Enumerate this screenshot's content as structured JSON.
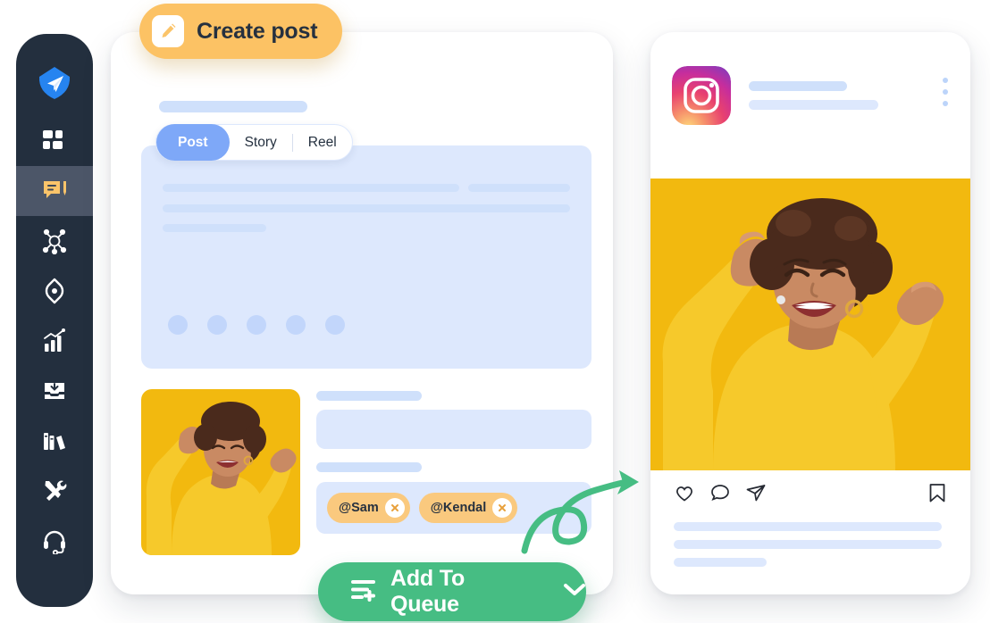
{
  "app": {
    "sidebar": {
      "items": [
        {
          "name": "logo",
          "icon": "paper-plane-logo-icon",
          "active": false
        },
        {
          "name": "dashboard",
          "icon": "grid-dashboard-icon",
          "active": false
        },
        {
          "name": "create-post",
          "icon": "chat-bubble-pencil-icon",
          "active": true
        },
        {
          "name": "engage",
          "icon": "network-nodes-icon",
          "active": false
        },
        {
          "name": "discover",
          "icon": "diamond-compass-icon",
          "active": false
        },
        {
          "name": "analytics",
          "icon": "bar-chart-growth-icon",
          "active": false
        },
        {
          "name": "inbox",
          "icon": "inbox-download-icon",
          "active": false
        },
        {
          "name": "library",
          "icon": "books-library-icon",
          "active": false
        },
        {
          "name": "tools",
          "icon": "wrench-screwdriver-icon",
          "active": false
        },
        {
          "name": "support",
          "icon": "headset-support-icon",
          "active": false
        }
      ]
    },
    "create_post_pill": {
      "label": "Create post",
      "icon": "pencil-square-icon",
      "bg_color": "#fcc264"
    },
    "editor": {
      "tabs": [
        {
          "label": "Post",
          "active": true
        },
        {
          "label": "Story",
          "active": false
        },
        {
          "label": "Reel",
          "active": false
        }
      ],
      "active_tab_color": "#7ea8f8",
      "tag_field": {
        "tags": [
          {
            "label": "@Sam",
            "remove_icon": "close-icon"
          },
          {
            "label": "@Kendal",
            "remove_icon": "close-icon"
          }
        ],
        "chip_color": "#fac97e"
      },
      "carousel_dot_count": 5
    },
    "queue_button": {
      "label": "Add To Queue",
      "leading_icon": "queue-list-add-icon",
      "trailing_icon": "chevron-down-icon",
      "bg_color": "#46bd83"
    },
    "arrow": {
      "icon": "curved-arrow-right-icon",
      "color": "#46bd83"
    },
    "preview": {
      "network": "instagram",
      "network_icon": "instagram-logo-icon",
      "menu_icon": "three-dots-vertical-icon",
      "photo_alt": "woman-in-yellow-sweater-celebrating",
      "actions": [
        {
          "name": "like",
          "icon": "heart-icon"
        },
        {
          "name": "comment",
          "icon": "comment-bubble-icon"
        },
        {
          "name": "share",
          "icon": "paper-plane-share-icon"
        },
        {
          "name": "save",
          "icon": "bookmark-icon"
        }
      ],
      "comment_like_icon": "heart-icon"
    }
  }
}
